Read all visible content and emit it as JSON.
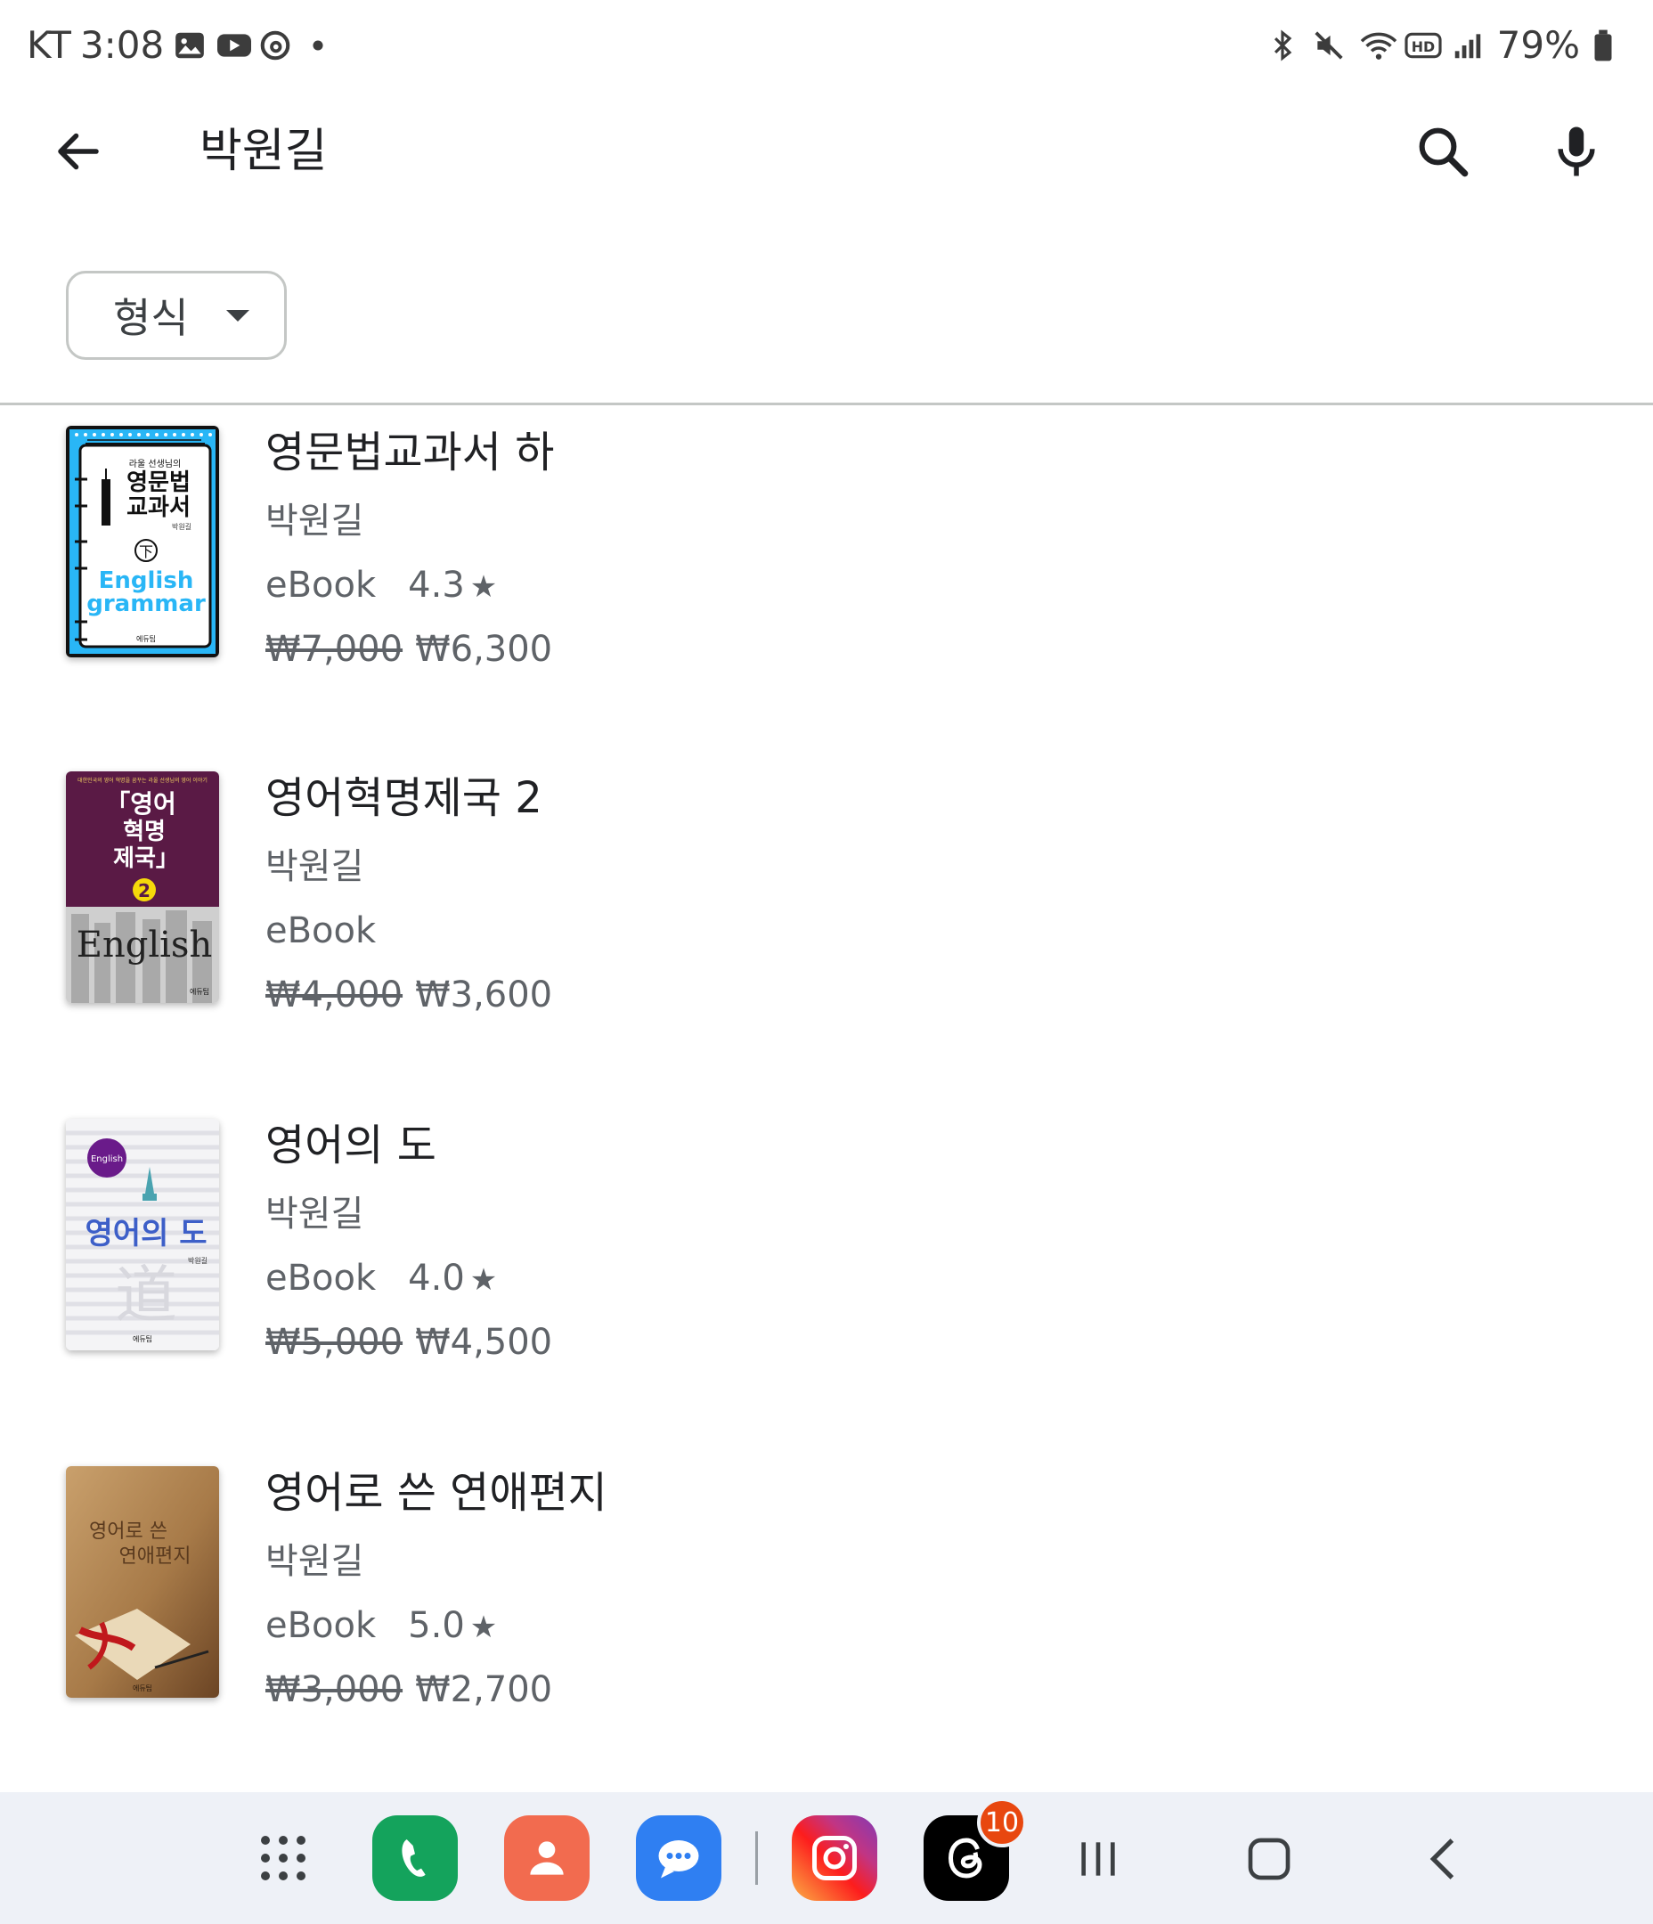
{
  "status_bar": {
    "carrier": "KT",
    "time": "3:08",
    "battery": "79%",
    "left_icons": [
      "gallery-icon",
      "youtube-icon",
      "threads-icon",
      "dot-icon"
    ],
    "right_icons": [
      "bluetooth-icon",
      "mute-icon",
      "wifi-icon",
      "hd-icon",
      "signal-icon",
      "battery-icon"
    ]
  },
  "search": {
    "query": "박원길"
  },
  "filter": {
    "label": "형식"
  },
  "books": [
    {
      "title": "영문법교과서 하",
      "author": "박원길",
      "format": "eBook",
      "rating": "4.3",
      "star": "★",
      "original_price": "₩7,000",
      "price": "₩6,300"
    },
    {
      "title": "영어혁명제국 2",
      "author": "박원길",
      "format": "eBook",
      "rating": "",
      "star": "",
      "original_price": "₩4,000",
      "price": "₩3,600"
    },
    {
      "title": "영어의 도",
      "author": "박원길",
      "format": "eBook",
      "rating": "4.0",
      "star": "★",
      "original_price": "₩5,000",
      "price": "₩4,500"
    },
    {
      "title": "영어로 쓴 연애편지",
      "author": "박원길",
      "format": "eBook",
      "rating": "5.0",
      "star": "★",
      "original_price": "₩3,000",
      "price": "₩2,700"
    }
  ],
  "covers": {
    "cover1": {
      "series": "라울 선생님의",
      "title_line1": "영문법",
      "title_line2": "교과서",
      "author": "박원길",
      "volume": "下",
      "english1": "English",
      "english2": "grammar",
      "publisher": "에듀팁"
    },
    "cover2": {
      "tagline": "대한민국의 영어 혁명을 꿈꾸는 라울 선생님의 영어 이야기",
      "line1": "「영어",
      "line2": "혁명",
      "line3": "제국」",
      "number": "2",
      "english": "English",
      "publisher": "에듀팁"
    },
    "cover3": {
      "badge": "English",
      "title": "영어의 도",
      "author": "박원길",
      "hanja": "道",
      "publisher": "에듀팁"
    },
    "cover4": {
      "line1": "영어로 쓴",
      "line2": "연애편지",
      "publisher": "에듀팁"
    }
  },
  "dock": {
    "apps": [
      "apps-grid-icon",
      "phone-app-icon",
      "contacts-app-icon",
      "messages-app-icon",
      "instagram-app-icon",
      "threads-app-icon"
    ],
    "threads_badge": "10"
  },
  "colors": {
    "accent_blue": "#29b6f6",
    "maroon": "#5a1a45",
    "star": "#5f6368",
    "nav_bg": "#eef1f7"
  }
}
